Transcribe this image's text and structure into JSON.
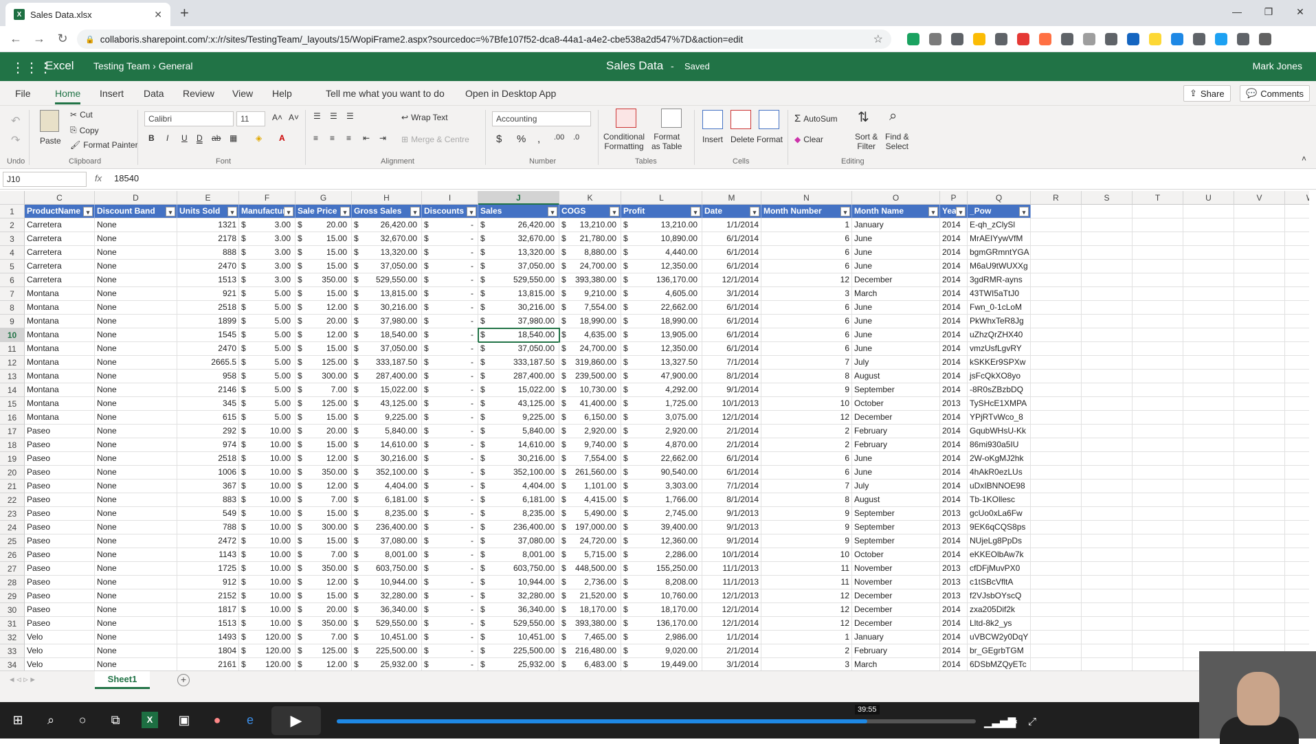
{
  "browser": {
    "tab_title": "Sales Data.xlsx",
    "tab_icon": "excel-icon",
    "url": "collaboris.sharepoint.com/:x:/r/sites/TestingTeam/_layouts/15/WopiFrame2.aspx?sourcedoc=%7Bfe107f52-dca8-44a1-a4e2-cbe538a2d547%7D&action=edit",
    "extension_colors": [
      "#1aa260",
      "#7b7b7b",
      "#5f6368",
      "#fbbc05",
      "#5f6368",
      "#e53935",
      "#ff7043",
      "#5f6368",
      "#9e9e9e",
      "#5f6368",
      "#1565c0",
      "#fdd835",
      "#1e88e5",
      "#5f6368",
      "#1da1f2",
      "#5f6368",
      "#616161"
    ]
  },
  "excel": {
    "app_name": "Excel",
    "breadcrumb_team": "Testing Team",
    "breadcrumb_sep": "›",
    "breadcrumb_channel": "General",
    "doc_title": "Sales Data",
    "title_sep": "-",
    "save_status": "Saved",
    "user": "Mark Jones",
    "brand_color": "#217346"
  },
  "menu": {
    "items": [
      "File",
      "Home",
      "Insert",
      "Data",
      "Review",
      "View",
      "Help"
    ],
    "active": "Home",
    "tell_me": "Tell me what you want to do",
    "open_desktop": "Open in Desktop App",
    "share": "Share",
    "comments": "Comments"
  },
  "ribbon": {
    "undo": "Undo",
    "paste": "Paste",
    "cut": "Cut",
    "copy": "Copy",
    "format_painter": "Format Painter",
    "clipboard": "Clipboard",
    "font_name": "Calibri",
    "font_size": "11",
    "font_group": "Font",
    "wrap_text": "Wrap Text",
    "merge_center": "Merge & Centre",
    "alignment": "Alignment",
    "number_format": "Accounting",
    "number": "Number",
    "cond_format_1": "Conditional",
    "cond_format_2": "Formatting",
    "format_table_1": "Format",
    "format_table_2": "as Table",
    "tables": "Tables",
    "insert": "Insert",
    "delete": "Delete",
    "format": "Format",
    "cells": "Cells",
    "autosum": "AutoSum",
    "clear": "Clear",
    "sort_1": "Sort &",
    "sort_2": "Filter",
    "find_1": "Find &",
    "find_2": "Select",
    "editing": "Editing"
  },
  "formula_bar": {
    "name_box": "J10",
    "fx": "fx",
    "value": "18540"
  },
  "grid": {
    "columns": [
      "C",
      "D",
      "E",
      "F",
      "G",
      "H",
      "I",
      "J",
      "K",
      "L",
      "M",
      "N",
      "O",
      "P",
      "Q",
      "R",
      "S",
      "T",
      "U",
      "V",
      "W"
    ],
    "selected_column": "J",
    "selected_row": "10",
    "headers": [
      "ProductName",
      "Discount Band",
      "Units Sold",
      "Manufacturin",
      "Sale Price",
      "Gross Sales",
      "Discounts",
      "Sales",
      "COGS",
      "Profit",
      "Date",
      "Month Number",
      "Month Name",
      "Year",
      "_Pow"
    ],
    "rows": [
      [
        "2",
        "Carretera",
        "None",
        "1321",
        "$",
        "3.00",
        "$",
        "20.00",
        "$",
        "26,420.00",
        "$",
        "-",
        "$",
        "26,420.00",
        "$",
        "13,210.00",
        "$",
        "13,210.00",
        "1/1/2014",
        "1",
        "January",
        "2014",
        "E-qh_zClySl"
      ],
      [
        "3",
        "Carretera",
        "None",
        "2178",
        "$",
        "3.00",
        "$",
        "15.00",
        "$",
        "32,670.00",
        "$",
        "-",
        "$",
        "32,670.00",
        "$",
        "21,780.00",
        "$",
        "10,890.00",
        "6/1/2014",
        "6",
        "June",
        "2014",
        "MrAEIYywVfM"
      ],
      [
        "4",
        "Carretera",
        "None",
        "888",
        "$",
        "3.00",
        "$",
        "15.00",
        "$",
        "13,320.00",
        "$",
        "-",
        "$",
        "13,320.00",
        "$",
        "8,880.00",
        "$",
        "4,440.00",
        "6/1/2014",
        "6",
        "June",
        "2014",
        "bgmGRmntYGA"
      ],
      [
        "5",
        "Carretera",
        "None",
        "2470",
        "$",
        "3.00",
        "$",
        "15.00",
        "$",
        "37,050.00",
        "$",
        "-",
        "$",
        "37,050.00",
        "$",
        "24,700.00",
        "$",
        "12,350.00",
        "6/1/2014",
        "6",
        "June",
        "2014",
        "M6aU9tWUXXg"
      ],
      [
        "6",
        "Carretera",
        "None",
        "1513",
        "$",
        "3.00",
        "$",
        "350.00",
        "$",
        "529,550.00",
        "$",
        "-",
        "$",
        "529,550.00",
        "$",
        "393,380.00",
        "$",
        "136,170.00",
        "12/1/2014",
        "12",
        "December",
        "2014",
        "3gdRMR-ayns"
      ],
      [
        "7",
        "Montana",
        "None",
        "921",
        "$",
        "5.00",
        "$",
        "15.00",
        "$",
        "13,815.00",
        "$",
        "-",
        "$",
        "13,815.00",
        "$",
        "9,210.00",
        "$",
        "4,605.00",
        "3/1/2014",
        "3",
        "March",
        "2014",
        "43TWI5aTtJ0"
      ],
      [
        "8",
        "Montana",
        "None",
        "2518",
        "$",
        "5.00",
        "$",
        "12.00",
        "$",
        "30,216.00",
        "$",
        "-",
        "$",
        "30,216.00",
        "$",
        "7,554.00",
        "$",
        "22,662.00",
        "6/1/2014",
        "6",
        "June",
        "2014",
        "Fwn_0-1cLoM"
      ],
      [
        "9",
        "Montana",
        "None",
        "1899",
        "$",
        "5.00",
        "$",
        "20.00",
        "$",
        "37,980.00",
        "$",
        "-",
        "$",
        "37,980.00",
        "$",
        "18,990.00",
        "$",
        "18,990.00",
        "6/1/2014",
        "6",
        "June",
        "2014",
        "PkWhxTeR8Jg"
      ],
      [
        "10",
        "Montana",
        "None",
        "1545",
        "$",
        "5.00",
        "$",
        "12.00",
        "$",
        "18,540.00",
        "$",
        "-",
        "$",
        "18,540.00",
        "$",
        "4,635.00",
        "$",
        "13,905.00",
        "6/1/2014",
        "6",
        "June",
        "2014",
        "uZhzQrZHX40"
      ],
      [
        "11",
        "Montana",
        "None",
        "2470",
        "$",
        "5.00",
        "$",
        "15.00",
        "$",
        "37,050.00",
        "$",
        "-",
        "$",
        "37,050.00",
        "$",
        "24,700.00",
        "$",
        "12,350.00",
        "6/1/2014",
        "6",
        "June",
        "2014",
        "vmzUsfLgvRY"
      ],
      [
        "12",
        "Montana",
        "None",
        "2665.5",
        "$",
        "5.00",
        "$",
        "125.00",
        "$",
        "333,187.50",
        "$",
        "-",
        "$",
        "333,187.50",
        "$",
        "319,860.00",
        "$",
        "13,327.50",
        "7/1/2014",
        "7",
        "July",
        "2014",
        "kSKKEr9SPXw"
      ],
      [
        "13",
        "Montana",
        "None",
        "958",
        "$",
        "5.00",
        "$",
        "300.00",
        "$",
        "287,400.00",
        "$",
        "-",
        "$",
        "287,400.00",
        "$",
        "239,500.00",
        "$",
        "47,900.00",
        "8/1/2014",
        "8",
        "August",
        "2014",
        "jsFcQkXO8yo"
      ],
      [
        "14",
        "Montana",
        "None",
        "2146",
        "$",
        "5.00",
        "$",
        "7.00",
        "$",
        "15,022.00",
        "$",
        "-",
        "$",
        "15,022.00",
        "$",
        "10,730.00",
        "$",
        "4,292.00",
        "9/1/2014",
        "9",
        "September",
        "2014",
        "-8R0sZBzbDQ"
      ],
      [
        "15",
        "Montana",
        "None",
        "345",
        "$",
        "5.00",
        "$",
        "125.00",
        "$",
        "43,125.00",
        "$",
        "-",
        "$",
        "43,125.00",
        "$",
        "41,400.00",
        "$",
        "1,725.00",
        "10/1/2013",
        "10",
        "October",
        "2013",
        "TySHcE1XMPA"
      ],
      [
        "16",
        "Montana",
        "None",
        "615",
        "$",
        "5.00",
        "$",
        "15.00",
        "$",
        "9,225.00",
        "$",
        "-",
        "$",
        "9,225.00",
        "$",
        "6,150.00",
        "$",
        "3,075.00",
        "12/1/2014",
        "12",
        "December",
        "2014",
        "YPjRTvWco_8"
      ],
      [
        "17",
        "Paseo",
        "None",
        "292",
        "$",
        "10.00",
        "$",
        "20.00",
        "$",
        "5,840.00",
        "$",
        "-",
        "$",
        "5,840.00",
        "$",
        "2,920.00",
        "$",
        "2,920.00",
        "2/1/2014",
        "2",
        "February",
        "2014",
        "GqubWHsU-Kk"
      ],
      [
        "18",
        "Paseo",
        "None",
        "974",
        "$",
        "10.00",
        "$",
        "15.00",
        "$",
        "14,610.00",
        "$",
        "-",
        "$",
        "14,610.00",
        "$",
        "9,740.00",
        "$",
        "4,870.00",
        "2/1/2014",
        "2",
        "February",
        "2014",
        "86mi930a5IU"
      ],
      [
        "19",
        "Paseo",
        "None",
        "2518",
        "$",
        "10.00",
        "$",
        "12.00",
        "$",
        "30,216.00",
        "$",
        "-",
        "$",
        "30,216.00",
        "$",
        "7,554.00",
        "$",
        "22,662.00",
        "6/1/2014",
        "6",
        "June",
        "2014",
        "2W-oKgMJ2hk"
      ],
      [
        "20",
        "Paseo",
        "None",
        "1006",
        "$",
        "10.00",
        "$",
        "350.00",
        "$",
        "352,100.00",
        "$",
        "-",
        "$",
        "352,100.00",
        "$",
        "261,560.00",
        "$",
        "90,540.00",
        "6/1/2014",
        "6",
        "June",
        "2014",
        "4hAkR0ezLUs"
      ],
      [
        "21",
        "Paseo",
        "None",
        "367",
        "$",
        "10.00",
        "$",
        "12.00",
        "$",
        "4,404.00",
        "$",
        "-",
        "$",
        "4,404.00",
        "$",
        "1,101.00",
        "$",
        "3,303.00",
        "7/1/2014",
        "7",
        "July",
        "2014",
        "uDxIBNNOE98"
      ],
      [
        "22",
        "Paseo",
        "None",
        "883",
        "$",
        "10.00",
        "$",
        "7.00",
        "$",
        "6,181.00",
        "$",
        "-",
        "$",
        "6,181.00",
        "$",
        "4,415.00",
        "$",
        "1,766.00",
        "8/1/2014",
        "8",
        "August",
        "2014",
        "Tb-1KOllesc"
      ],
      [
        "23",
        "Paseo",
        "None",
        "549",
        "$",
        "10.00",
        "$",
        "15.00",
        "$",
        "8,235.00",
        "$",
        "-",
        "$",
        "8,235.00",
        "$",
        "5,490.00",
        "$",
        "2,745.00",
        "9/1/2013",
        "9",
        "September",
        "2013",
        "gcUo0xLa6Fw"
      ],
      [
        "24",
        "Paseo",
        "None",
        "788",
        "$",
        "10.00",
        "$",
        "300.00",
        "$",
        "236,400.00",
        "$",
        "-",
        "$",
        "236,400.00",
        "$",
        "197,000.00",
        "$",
        "39,400.00",
        "9/1/2013",
        "9",
        "September",
        "2013",
        "9EK6qCQS8ps"
      ],
      [
        "25",
        "Paseo",
        "None",
        "2472",
        "$",
        "10.00",
        "$",
        "15.00",
        "$",
        "37,080.00",
        "$",
        "-",
        "$",
        "37,080.00",
        "$",
        "24,720.00",
        "$",
        "12,360.00",
        "9/1/2014",
        "9",
        "September",
        "2014",
        "NUjeLg8PpDs"
      ],
      [
        "26",
        "Paseo",
        "None",
        "1143",
        "$",
        "10.00",
        "$",
        "7.00",
        "$",
        "8,001.00",
        "$",
        "-",
        "$",
        "8,001.00",
        "$",
        "5,715.00",
        "$",
        "2,286.00",
        "10/1/2014",
        "10",
        "October",
        "2014",
        "eKKEOlbAw7k"
      ],
      [
        "27",
        "Paseo",
        "None",
        "1725",
        "$",
        "10.00",
        "$",
        "350.00",
        "$",
        "603,750.00",
        "$",
        "-",
        "$",
        "603,750.00",
        "$",
        "448,500.00",
        "$",
        "155,250.00",
        "11/1/2013",
        "11",
        "November",
        "2013",
        "cfDFjMuvPX0"
      ],
      [
        "28",
        "Paseo",
        "None",
        "912",
        "$",
        "10.00",
        "$",
        "12.00",
        "$",
        "10,944.00",
        "$",
        "-",
        "$",
        "10,944.00",
        "$",
        "2,736.00",
        "$",
        "8,208.00",
        "11/1/2013",
        "11",
        "November",
        "2013",
        "c1tSBcVfltA"
      ],
      [
        "29",
        "Paseo",
        "None",
        "2152",
        "$",
        "10.00",
        "$",
        "15.00",
        "$",
        "32,280.00",
        "$",
        "-",
        "$",
        "32,280.00",
        "$",
        "21,520.00",
        "$",
        "10,760.00",
        "12/1/2013",
        "12",
        "December",
        "2013",
        "f2VJsbOYscQ"
      ],
      [
        "30",
        "Paseo",
        "None",
        "1817",
        "$",
        "10.00",
        "$",
        "20.00",
        "$",
        "36,340.00",
        "$",
        "-",
        "$",
        "36,340.00",
        "$",
        "18,170.00",
        "$",
        "18,170.00",
        "12/1/2014",
        "12",
        "December",
        "2014",
        "zxa205Dif2k"
      ],
      [
        "31",
        "Paseo",
        "None",
        "1513",
        "$",
        "10.00",
        "$",
        "350.00",
        "$",
        "529,550.00",
        "$",
        "-",
        "$",
        "529,550.00",
        "$",
        "393,380.00",
        "$",
        "136,170.00",
        "12/1/2014",
        "12",
        "December",
        "2014",
        "Lltd-8k2_ys"
      ],
      [
        "32",
        "Velo",
        "None",
        "1493",
        "$",
        "120.00",
        "$",
        "7.00",
        "$",
        "10,451.00",
        "$",
        "-",
        "$",
        "10,451.00",
        "$",
        "7,465.00",
        "$",
        "2,986.00",
        "1/1/2014",
        "1",
        "January",
        "2014",
        "uVBCW2y0DqY"
      ],
      [
        "33",
        "Velo",
        "None",
        "1804",
        "$",
        "120.00",
        "$",
        "125.00",
        "$",
        "225,500.00",
        "$",
        "-",
        "$",
        "225,500.00",
        "$",
        "216,480.00",
        "$",
        "9,020.00",
        "2/1/2014",
        "2",
        "February",
        "2014",
        "br_GEgrbTGM"
      ],
      [
        "34",
        "Velo",
        "None",
        "2161",
        "$",
        "120.00",
        "$",
        "12.00",
        "$",
        "25,932.00",
        "$",
        "-",
        "$",
        "25,932.00",
        "$",
        "6,483.00",
        "$",
        "19,449.00",
        "3/1/2014",
        "3",
        "March",
        "2014",
        "6DSbMZQyETc"
      ]
    ]
  },
  "sheets": [
    "Sheet1"
  ],
  "video": {
    "time": "39:55",
    "progress": 0.83,
    "play_icon": "play-icon"
  },
  "taskbar_icons": [
    "windows-icon",
    "search-icon",
    "cortana-icon",
    "task-view-icon",
    "excel-icon",
    "store-icon",
    "app-icon",
    "edge-icon"
  ]
}
